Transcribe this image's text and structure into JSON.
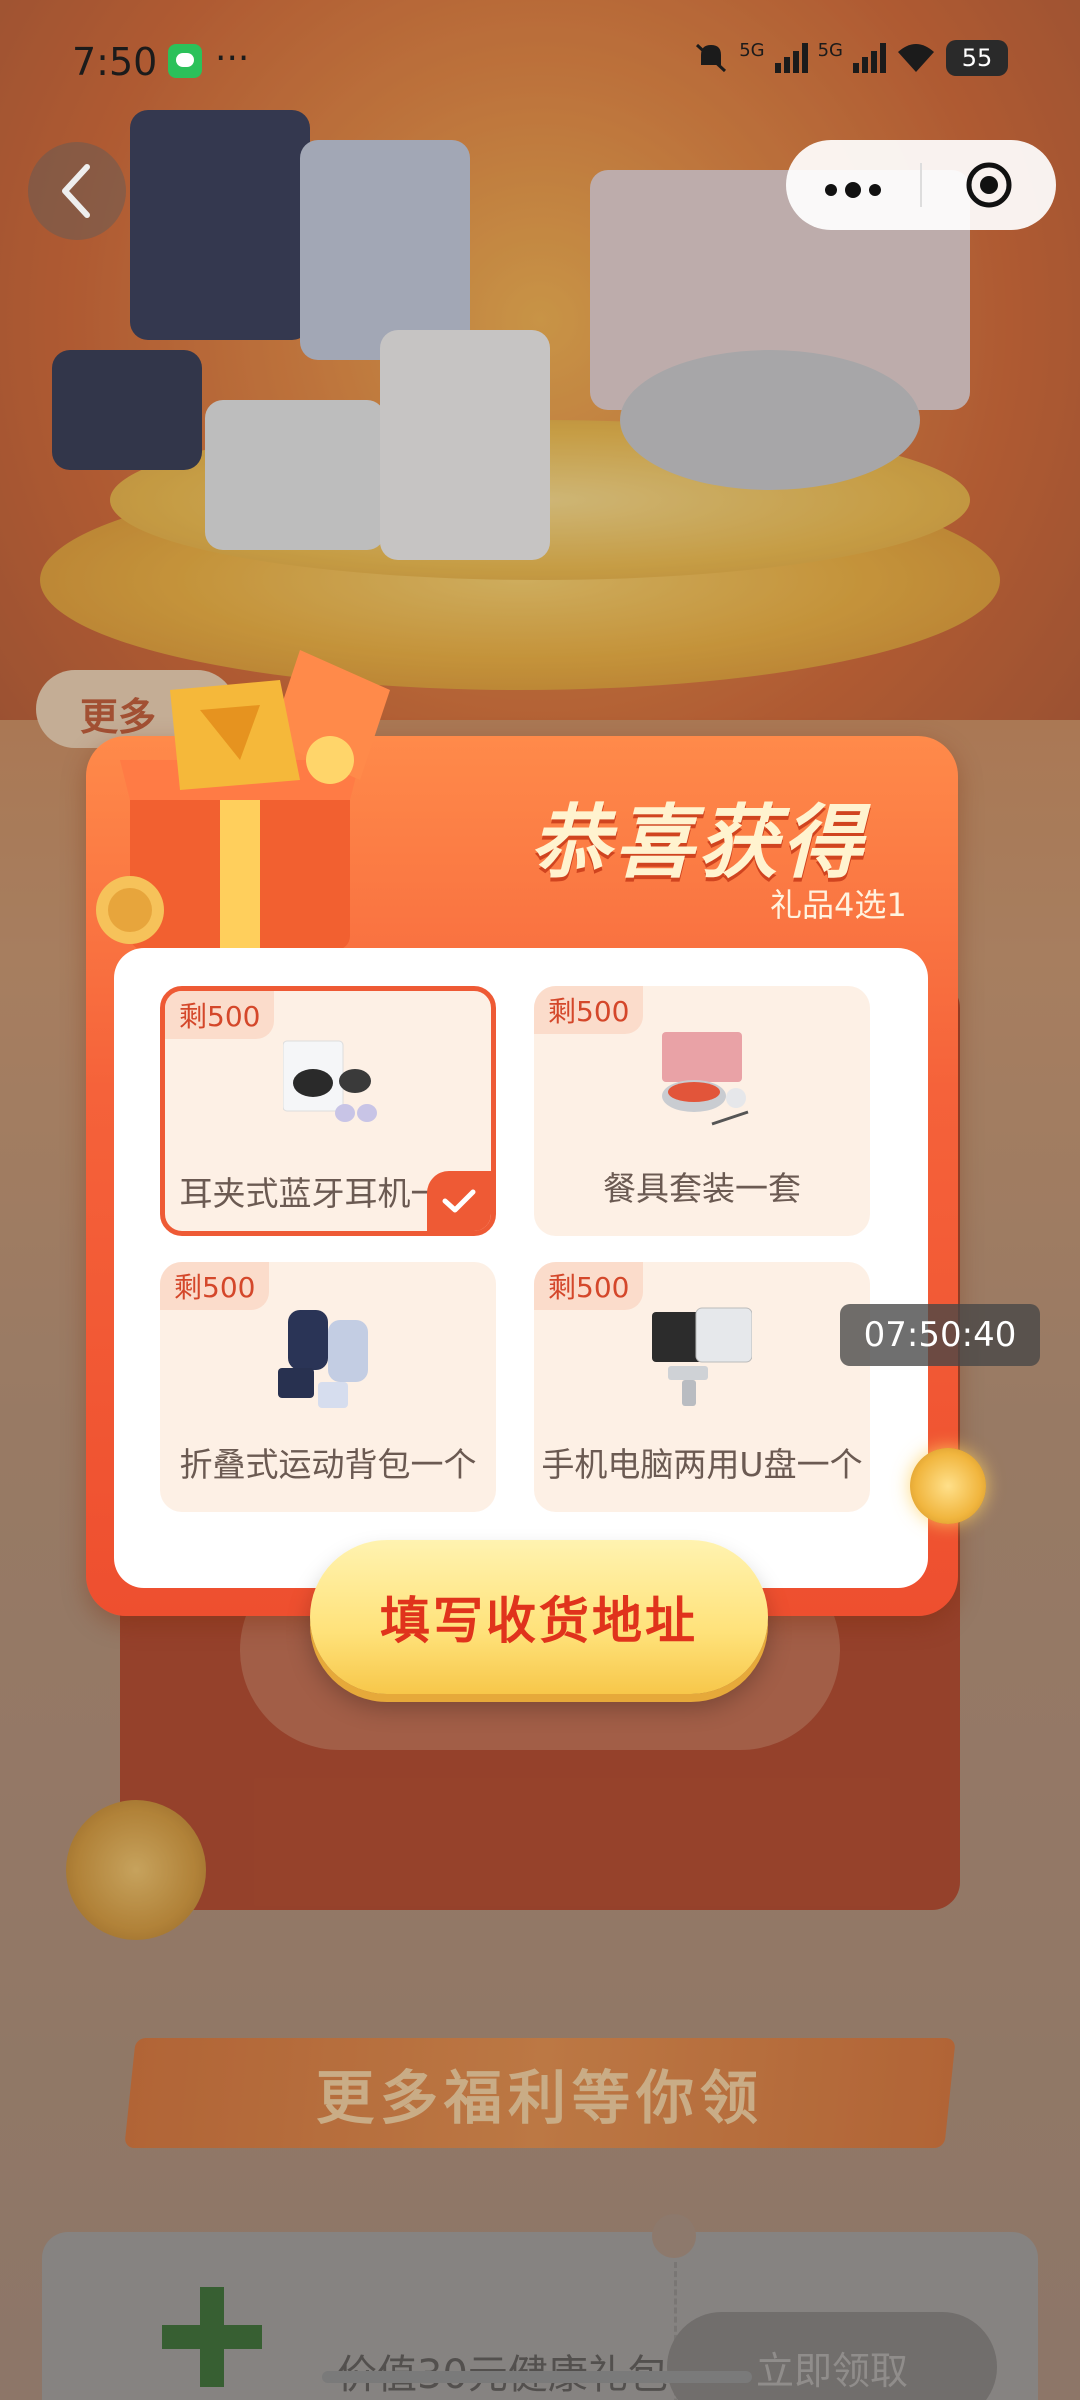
{
  "status_bar": {
    "time": "7:50",
    "dots": "···",
    "network_1": "5G",
    "network_2": "5G",
    "battery": "55"
  },
  "nav": {
    "back_icon": "chevron-left-icon",
    "more_icon": "more-dots-icon",
    "close_icon": "target-icon",
    "more_label": "•••"
  },
  "modal": {
    "title": "恭喜获得",
    "subtitle": "礼品4选1",
    "items": [
      {
        "stock": "剩500",
        "name": "耳夹式蓝牙耳机一个",
        "selected": true,
        "icon": "earbuds-icon"
      },
      {
        "stock": "剩500",
        "name": "餐具套装一套",
        "selected": false,
        "icon": "tableware-icon"
      },
      {
        "stock": "剩500",
        "name": "折叠式运动背包一个",
        "selected": false,
        "icon": "backpack-icon"
      },
      {
        "stock": "剩500",
        "name": "手机电脑两用U盘一个",
        "selected": false,
        "icon": "usb-drive-icon"
      }
    ],
    "cta": "填写收货地址"
  },
  "timer": "07:50:40",
  "background": {
    "pill_text": "更多",
    "banner": "更多福利等你领",
    "card_label": "价值30元健康礼包",
    "card_button": "立即领取"
  },
  "colors": {
    "accent": "#ee5a35",
    "cta_text": "#e0331c",
    "cta_bg": "#ffe27a",
    "title": "#fff3cf"
  }
}
